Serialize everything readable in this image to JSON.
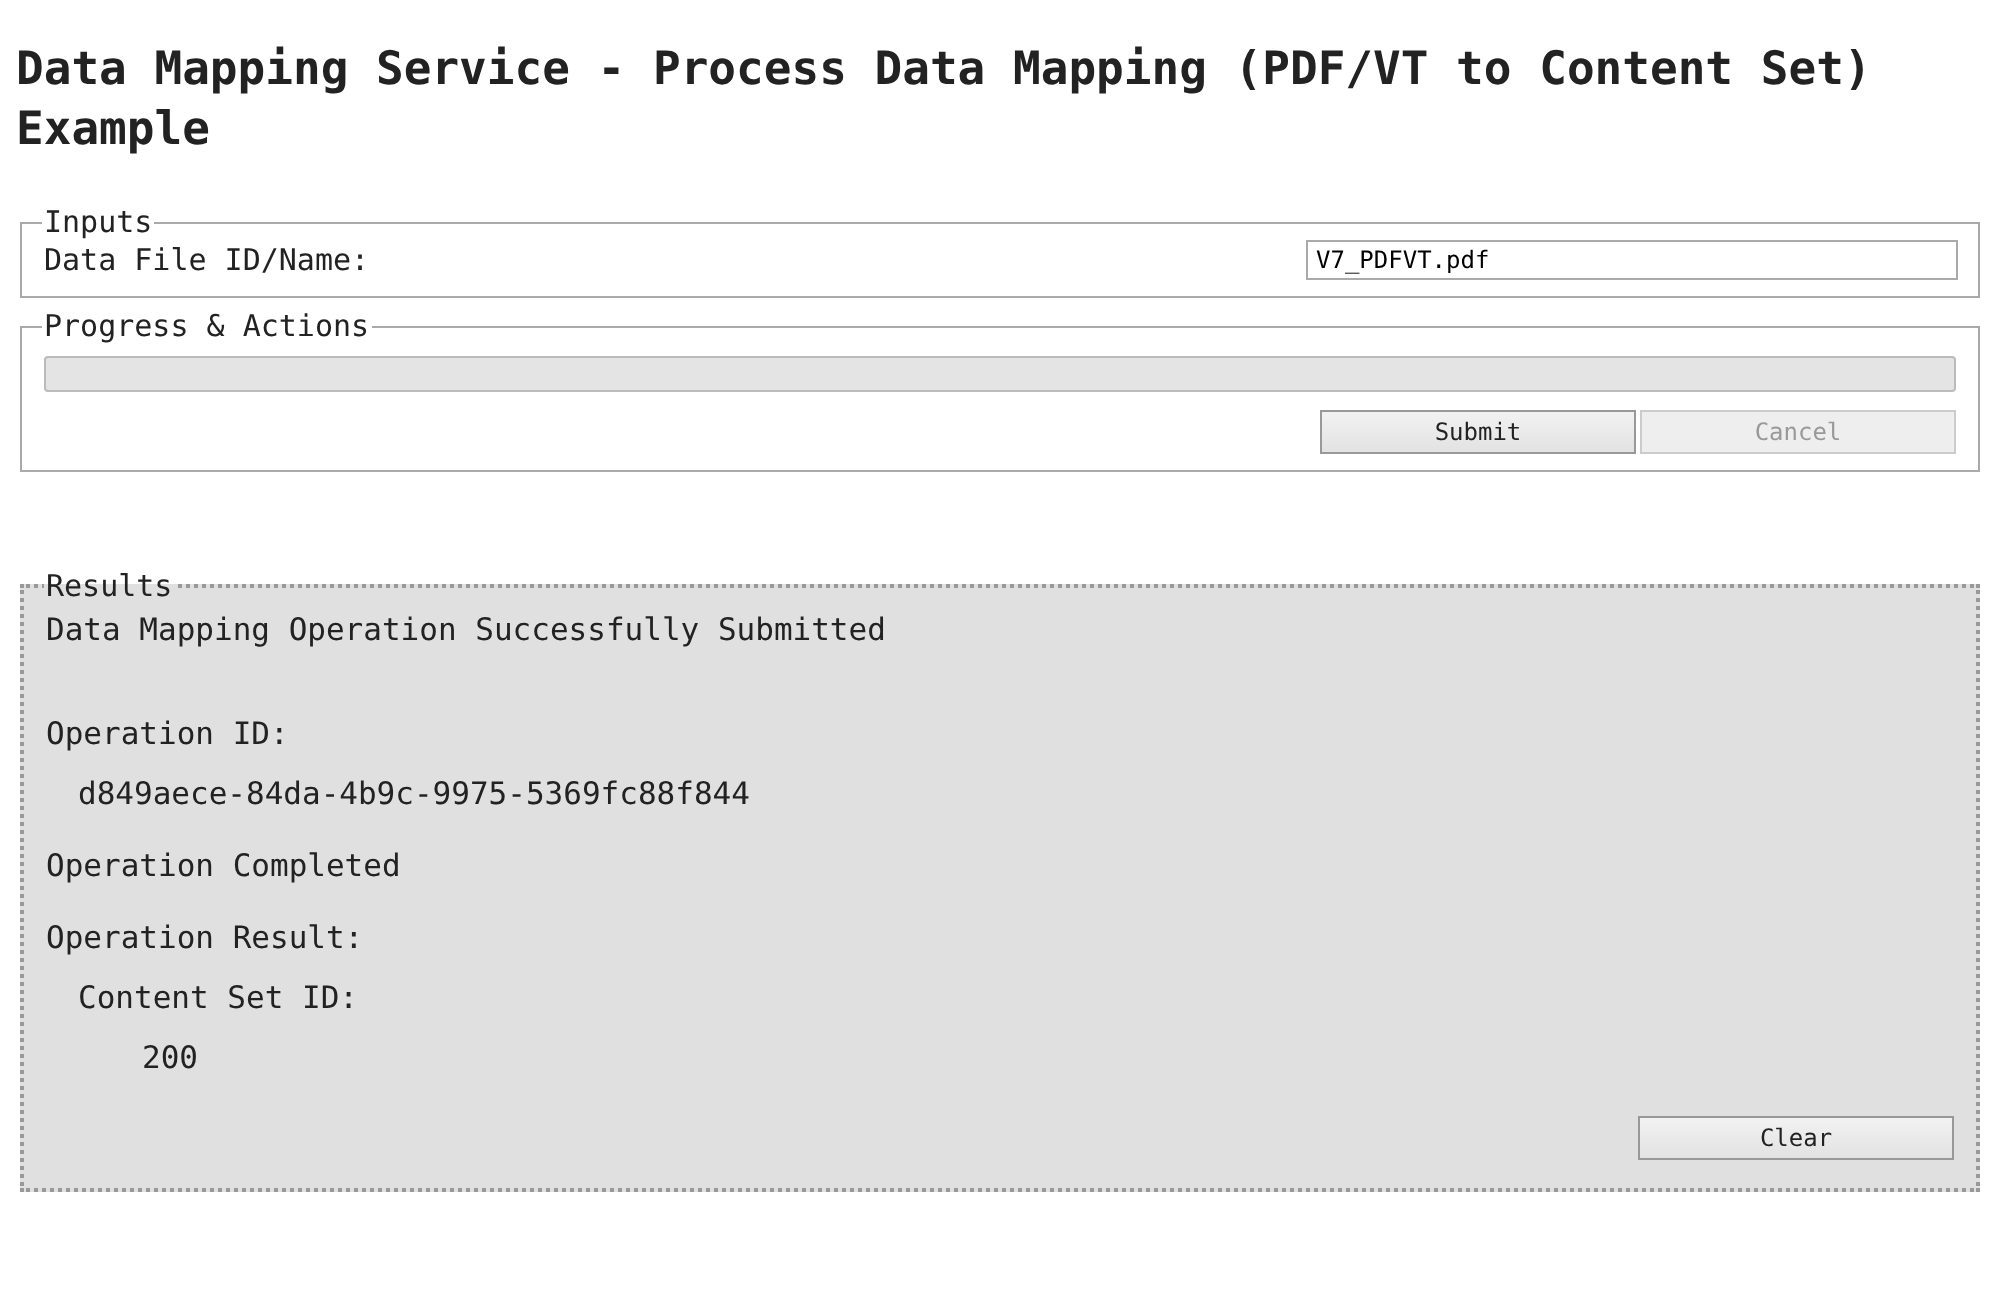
{
  "title": "Data Mapping Service - Process Data Mapping (PDF/VT to Content Set) Example",
  "inputs": {
    "legend": "Inputs",
    "fields": [
      {
        "label": "Data File ID/Name:",
        "value": "V7_PDFVT.pdf"
      }
    ]
  },
  "progress": {
    "legend": "Progress & Actions",
    "level": 0,
    "buttons": [
      {
        "label": "Submit",
        "disabled": false
      },
      {
        "label": "Cancel",
        "disabled": true
      }
    ]
  },
  "results": {
    "legend": "Results",
    "lines": [
      {
        "text": "Data Mapping Operation Successfully Submitted"
      },
      {
        "text": "Operation ID:",
        "children": [
          {
            "text": "d849aece-84da-4b9c-9975-5369fc88f844"
          }
        ]
      },
      {
        "text": "Operation Completed"
      },
      {
        "text": "Operation Result:",
        "children": [
          {
            "text": "Content Set ID:",
            "children": [
              {
                "text": "200"
              }
            ]
          }
        ]
      }
    ],
    "buttons": [
      {
        "label": "Clear",
        "disabled": false
      }
    ]
  }
}
